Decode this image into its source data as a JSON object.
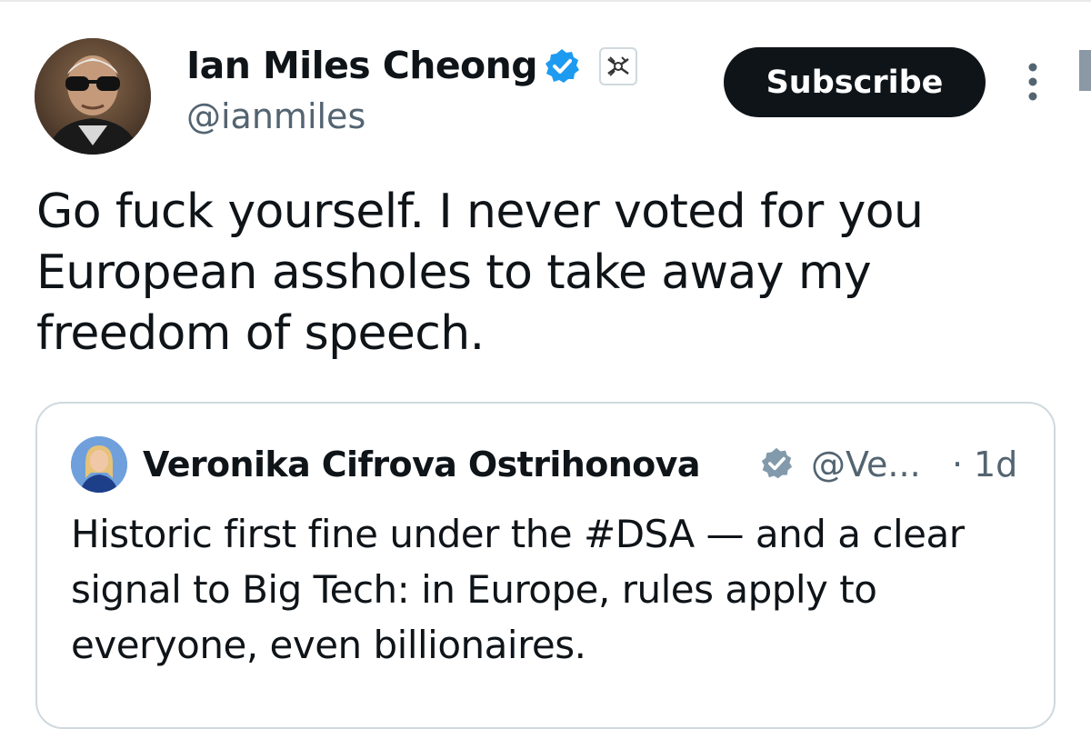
{
  "tweet": {
    "author_name": "Ian Miles Cheong",
    "author_handle": "@ianmiles",
    "subscribe_label": "Subscribe",
    "text": "Go fuck yourself. I never voted for you European assholes to take away my freedom of speech."
  },
  "quote": {
    "author_name": "Veronika Cifrova Ostrihonova",
    "author_handle": "@Ve...",
    "separator": "·",
    "time": "1d",
    "text": "Historic first fine under the #DSA — and a clear signal to Big Tech: in Europe, rules apply to everyone, even billionaires."
  },
  "icons": {
    "verified": "verified-badge-icon",
    "affiliate": "affiliate-badge-icon",
    "more": "more-options-icon"
  },
  "colors": {
    "verified_blue": "#1d9bf0",
    "gray_verified": "#829aab",
    "text_primary": "#0f1419",
    "text_secondary": "#536471",
    "button_bg": "#0f1419",
    "border": "#cfd9de"
  }
}
